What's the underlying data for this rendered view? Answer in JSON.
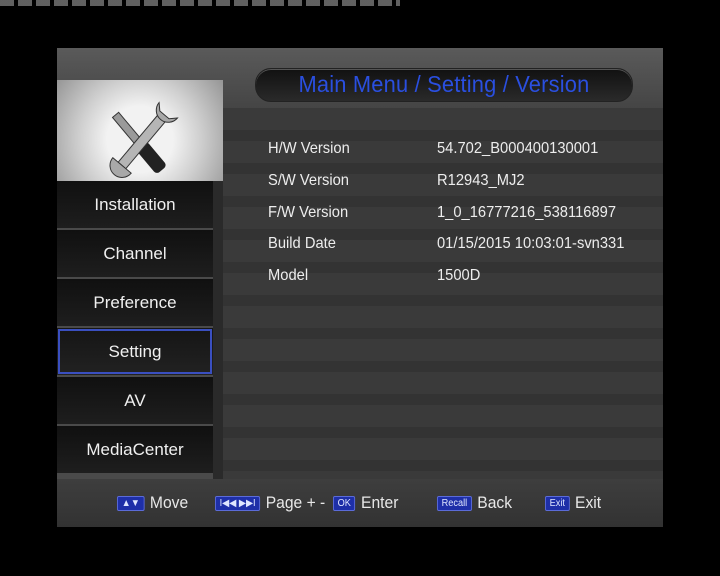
{
  "header": {
    "title": "Main Menu / Setting / Version"
  },
  "menu": {
    "items": [
      {
        "label": "Installation"
      },
      {
        "label": "Channel"
      },
      {
        "label": "Preference"
      },
      {
        "label": "Setting"
      },
      {
        "label": "AV"
      },
      {
        "label": "MediaCenter"
      }
    ]
  },
  "version": {
    "rows": [
      {
        "label": "H/W Version",
        "value": "54.702_B000400130001"
      },
      {
        "label": "S/W Version",
        "value": "R12943_MJ2"
      },
      {
        "label": "F/W Version",
        "value": "1_0_16777216_538116897"
      },
      {
        "label": "Build Date",
        "value": "01/15/2015 10:03:01-svn331"
      },
      {
        "label": "Model",
        "value": "1500D"
      }
    ]
  },
  "footer": {
    "move": {
      "key": "▲▼",
      "label": "Move"
    },
    "page": {
      "key": "I◀◀ ▶▶I",
      "label": "Page + -"
    },
    "enter": {
      "key": "OK",
      "label": "Enter"
    },
    "back": {
      "key": "Recall",
      "label": "Back"
    },
    "exit": {
      "key": "Exit",
      "label": "Exit"
    }
  }
}
